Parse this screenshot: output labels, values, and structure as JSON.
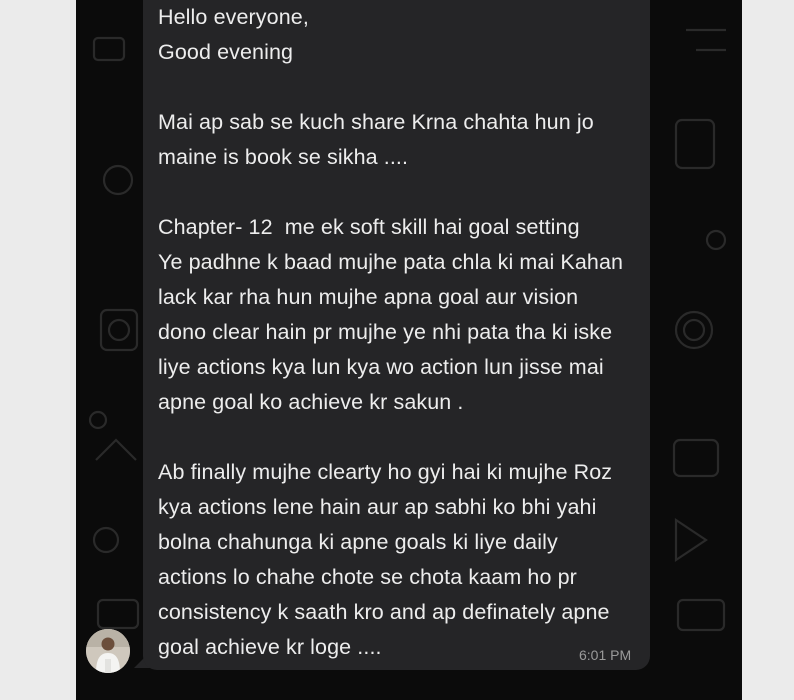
{
  "message": {
    "lines": [
      "Hello everyone,",
      "Good evening",
      "",
      "Mai ap sab se kuch share Krna chahta hun jo",
      "maine is book se sikha ....",
      "",
      "Chapter- 12  me ek soft skill hai goal setting",
      "Ye padhne k baad mujhe pata chla ki mai Kahan",
      "lack kar rha hun mujhe apna goal aur vision",
      "dono clear hain pr mujhe ye nhi pata tha ki iske",
      "liye actions kya lun kya wo action lun jisse mai",
      "apne goal ko achieve kr sakun .",
      "",
      "Ab finally mujhe clearty ho gyi hai ki mujhe Roz",
      "kya actions lene hain aur ap sabhi ko bhi yahi",
      "bolna chahunga ki apne goals ki liye daily",
      "actions lo chahe chote se chota kaam ho pr",
      "consistency k saath kro and ap definately apne",
      "goal achieve kr loge ...."
    ],
    "time": "6:01 PM"
  },
  "colors": {
    "chat_background": "#0b0b0b",
    "bubble": "#252527",
    "text": "#ededed",
    "timestamp": "#9a9a9a"
  }
}
